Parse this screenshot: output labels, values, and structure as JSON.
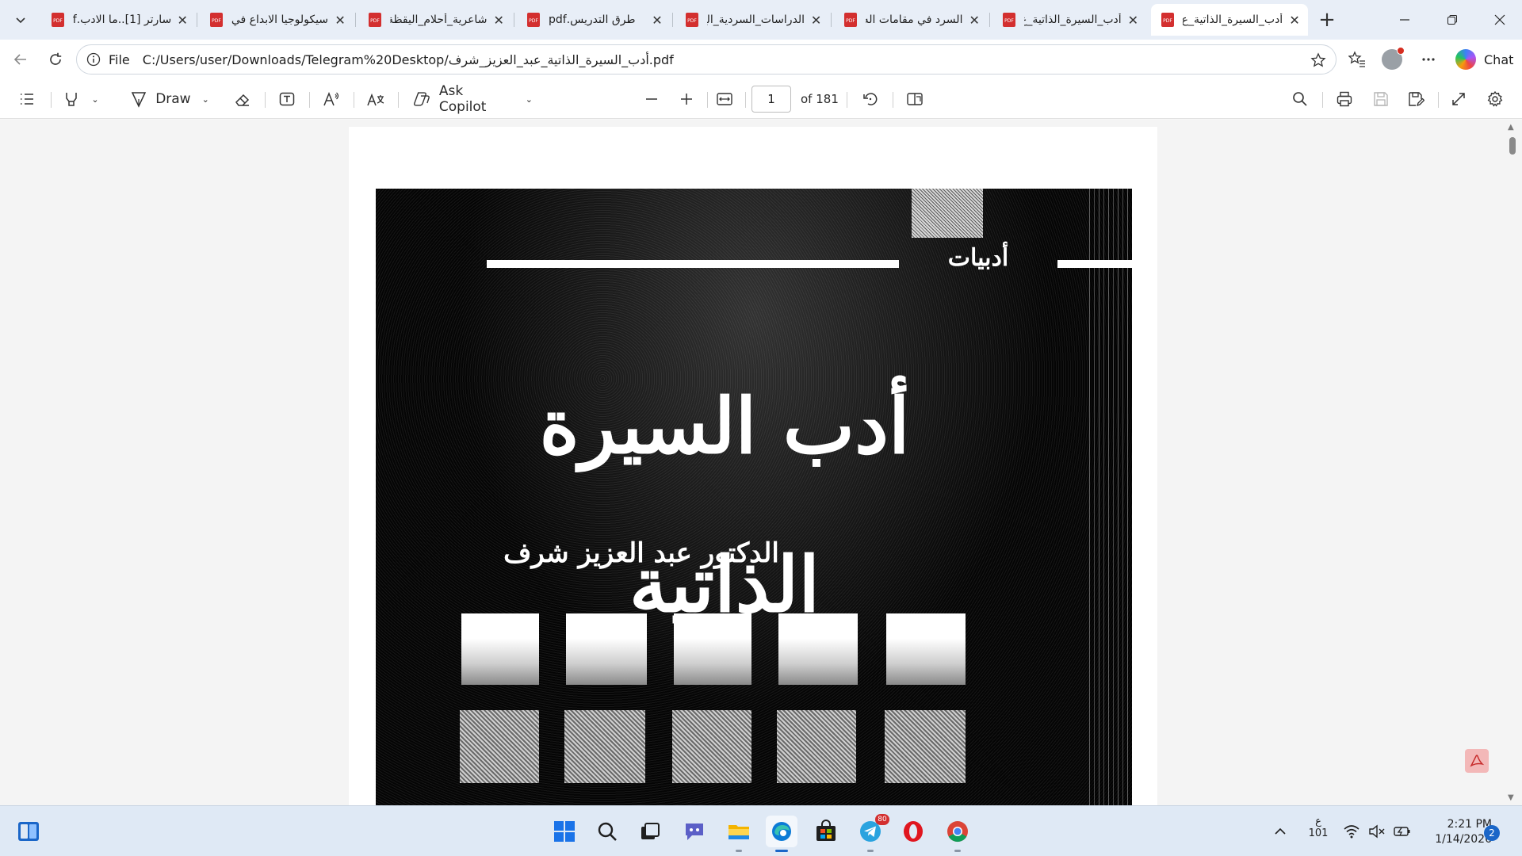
{
  "browser": {
    "tabs": [
      {
        "title": "سارتر [1]..ما الادب.pdf",
        "active": false
      },
      {
        "title": "سيكولوجيا الابداع في",
        "active": false
      },
      {
        "title": "شاعرية_أحلام_اليقظة",
        "active": false
      },
      {
        "title": "طرق التدريس.pdf",
        "active": false
      },
      {
        "title": "الدراسات_السردية_الع",
        "active": false
      },
      {
        "title": "السرد في مقامات اله",
        "active": false
      },
      {
        "title": "أدب_السيرة_الذاتية_ع",
        "active": false
      },
      {
        "title": "أدب_السيرة_الذاتية_ع",
        "active": true
      }
    ],
    "close_glyph": "✕",
    "new_tab_glyph": "+",
    "address": {
      "scheme": "File",
      "url": "C:/Users/user/Downloads/Telegram%20Desktop/أدب_السيرة_الذاتية_عبد_العزيز_شرف.pdf"
    },
    "chat_label": "Chat"
  },
  "pdf_toolbar": {
    "draw_label": "Draw",
    "ask_copilot_label": "Ask Copilot",
    "page_current": "1",
    "page_total": "of 181"
  },
  "document": {
    "series_label": "أدبيات",
    "book_title": "أدب السيرة الذاتية",
    "author": "الدكتور عبد العزيز شرف"
  },
  "taskbar": {
    "telegram_badge": "80",
    "keyboard_lang_top": "ع",
    "keyboard_lang_bottom": "101",
    "time": "2:21 PM",
    "date": "1/14/2026",
    "notifications": "2"
  },
  "colors": {
    "accent": "#1a66c8",
    "pdf_icon_red": "#d32f2f",
    "tabstrip_bg": "#e8eef7",
    "taskbar_bg": "#dfe9f5"
  }
}
